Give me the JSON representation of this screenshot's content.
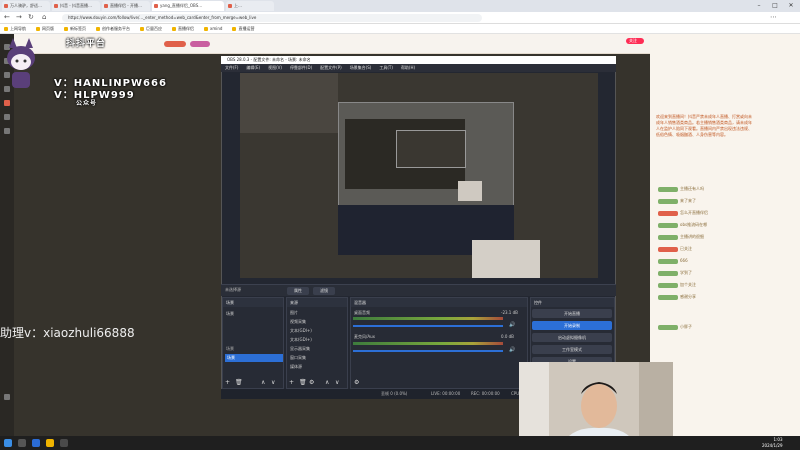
{
  "browser": {
    "tabs": [
      "万人骑驴，舒适…",
      "抖音 - 抖音直播…",
      "直播伴侣 - 开播…",
      "yang_直播伴侣_OBS…",
      "上…"
    ],
    "url": "https://www.douyin.com/follow/live/..._enter_method=web_card&enter_from_merge=web_live",
    "bookmarks": [
      "上网导航",
      "网页版",
      "新标签页",
      "创作者服务平台",
      "巨量百应",
      "直播伴侣",
      "xmind",
      "直播运营"
    ]
  },
  "watermark": {
    "brand": "抖抖平台",
    "line1": "V：HANLINPW666",
    "line2": "V：HLPW999",
    "line3": "公众号"
  },
  "assistant_text": "助理v：xiaozhuli66888",
  "obs": {
    "title": "OBS 28.0.3 - 配置文件: 未命名 - 场景: 未命名",
    "menu": [
      "文件(F)",
      "编辑(E)",
      "视图(V)",
      "停靠部件(D)",
      "配置文件(P)",
      "场景集合(S)",
      "工具(T)",
      "帮助(H)"
    ],
    "source_controls": [
      "属性",
      "滤镜"
    ],
    "no_source": "未选择源",
    "docks": {
      "scenes_title": "场景",
      "sources_title": "来源",
      "mixer_title": "混音器",
      "transitions_title": "场景转场",
      "controls_title": "控件"
    },
    "scene_items": [
      "场景"
    ],
    "scene_list_head": "场景",
    "scene_selected": "场景",
    "sources": [
      "图片",
      "视频采集",
      "文本(GDI+)",
      "文本(GDI+)",
      "显示器采集",
      "窗口采集",
      "媒体源"
    ],
    "mixer": {
      "track1": "桌面音频",
      "track1_db": "-23.1 dB",
      "track2": "麦克风/Aux",
      "track2_db": "0.0 dB"
    },
    "transition": "淡入淡出",
    "duration_label": "时长",
    "duration": "300 ms",
    "controls": [
      "开始直播",
      "开始录制",
      "启动虚拟摄像机",
      "工作室模式",
      "设置",
      "退出"
    ],
    "status": {
      "dropped": "丢帧 0 (0.0%)",
      "live": "LIVE: 00:00:00",
      "rec": "REC: 00:00:00",
      "cpu": "CPU: 3.2%, 30.00 fps"
    }
  },
  "chat": {
    "header_btn": "关注",
    "messages": [
      "主播还有人吗",
      "来了来了",
      "怎么开直播伴侣",
      "obs推流码在哪",
      "主播讲的很细",
      "已关注",
      "666",
      "学到了",
      "加个关注",
      "感谢分享"
    ],
    "notice": "欢迎来到直播间！抖音严禁未成年人直播、打赏或向未成年人销售酒类商品。若主播销售酒类商品，请未成年人在监护人陪同下观看。直播间内严禁出现违法违规、低俗色情、吸烟酗酒、人身伤害等内容。",
    "bottom_msg": "小胖子"
  },
  "taskbar": {
    "time": "1:03",
    "date": "2024/1/29"
  },
  "colors": {
    "accent": "#2c6fd6",
    "brand": "#e0604a",
    "obs_bg": "#232731"
  }
}
